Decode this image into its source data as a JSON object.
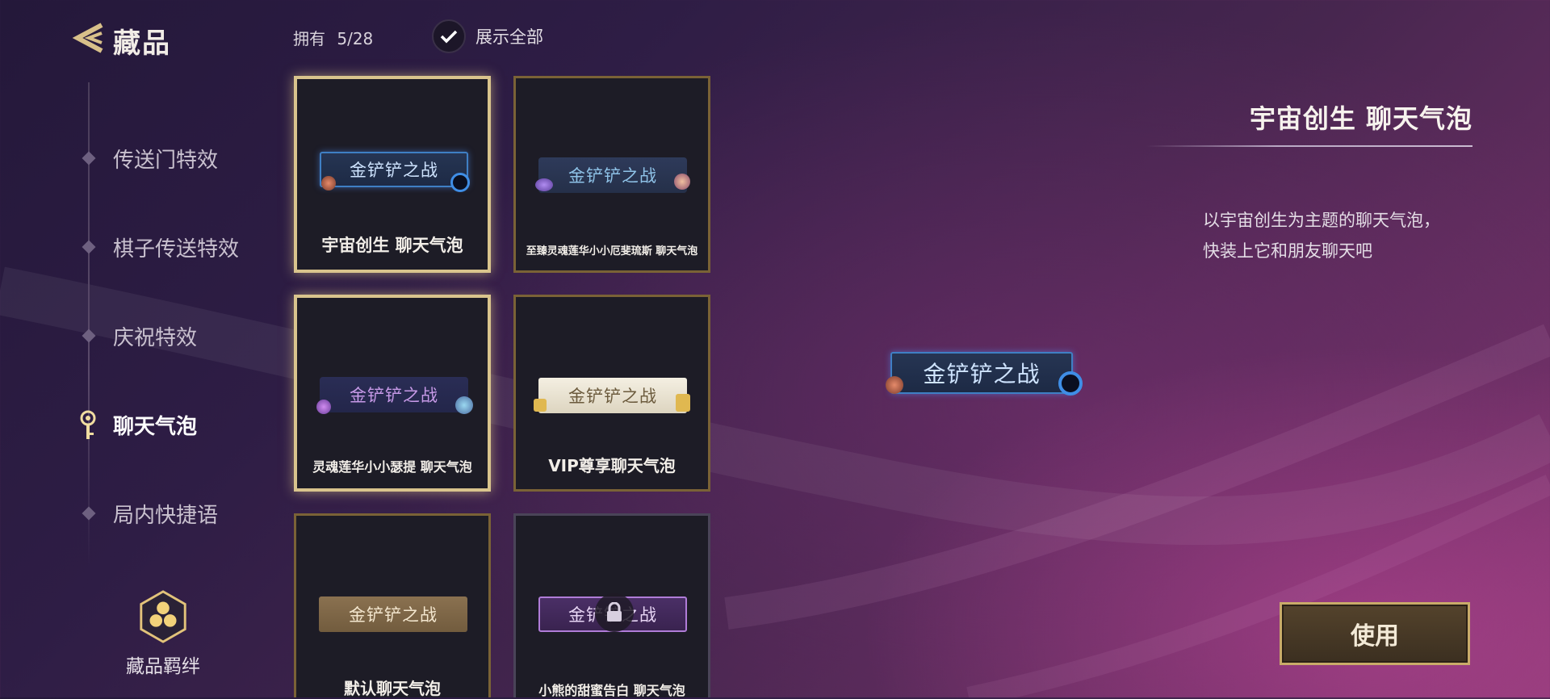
{
  "header": {
    "title": "藏品",
    "owned_label": "拥有",
    "owned_value": "5/28",
    "show_all_label": "展示全部"
  },
  "sidebar": {
    "items": [
      {
        "label": "传送门特效"
      },
      {
        "label": "棋子传送特效"
      },
      {
        "label": "庆祝特效"
      },
      {
        "label": "聊天气泡"
      },
      {
        "label": "局内快捷语"
      }
    ],
    "active_item": "聊天气泡",
    "bond_label": "藏品羁绊"
  },
  "grid": {
    "items": [
      {
        "name": "宇宙创生  聊天气泡",
        "bubble_text": "金铲铲之战",
        "style": "cosmic",
        "selected": true,
        "locked": false
      },
      {
        "name": "至臻灵魂莲华小小厄斐琉斯  聊天气泡",
        "bubble_text": "金铲铲之战",
        "style": "lotus",
        "selected": false,
        "locked": false
      },
      {
        "name": "灵魂莲华小小瑟提  聊天气泡",
        "bubble_text": "金铲铲之战",
        "style": "soul",
        "selected": true,
        "locked": false
      },
      {
        "name": "VIP尊享聊天气泡",
        "bubble_text": "金铲铲之战",
        "style": "vip",
        "selected": false,
        "locked": false
      },
      {
        "name": "默认聊天气泡",
        "bubble_text": "金铲铲之战",
        "style": "default",
        "selected": false,
        "locked": false
      },
      {
        "name": "小熊的甜蜜告白  聊天气泡",
        "bubble_text": "金铲铲之战",
        "style": "bear",
        "selected": false,
        "locked": true
      }
    ]
  },
  "detail": {
    "title": "宇宙创生  聊天气泡",
    "description_line1": "以宇宙创生为主题的聊天气泡，",
    "description_line2": "快装上它和朋友聊天吧",
    "preview_text": "金铲铲之战",
    "use_button": "使用"
  },
  "colors": {
    "accent_gold": "#c9ab69",
    "selected_border": "#d9c48d",
    "background": "#3a2148"
  }
}
